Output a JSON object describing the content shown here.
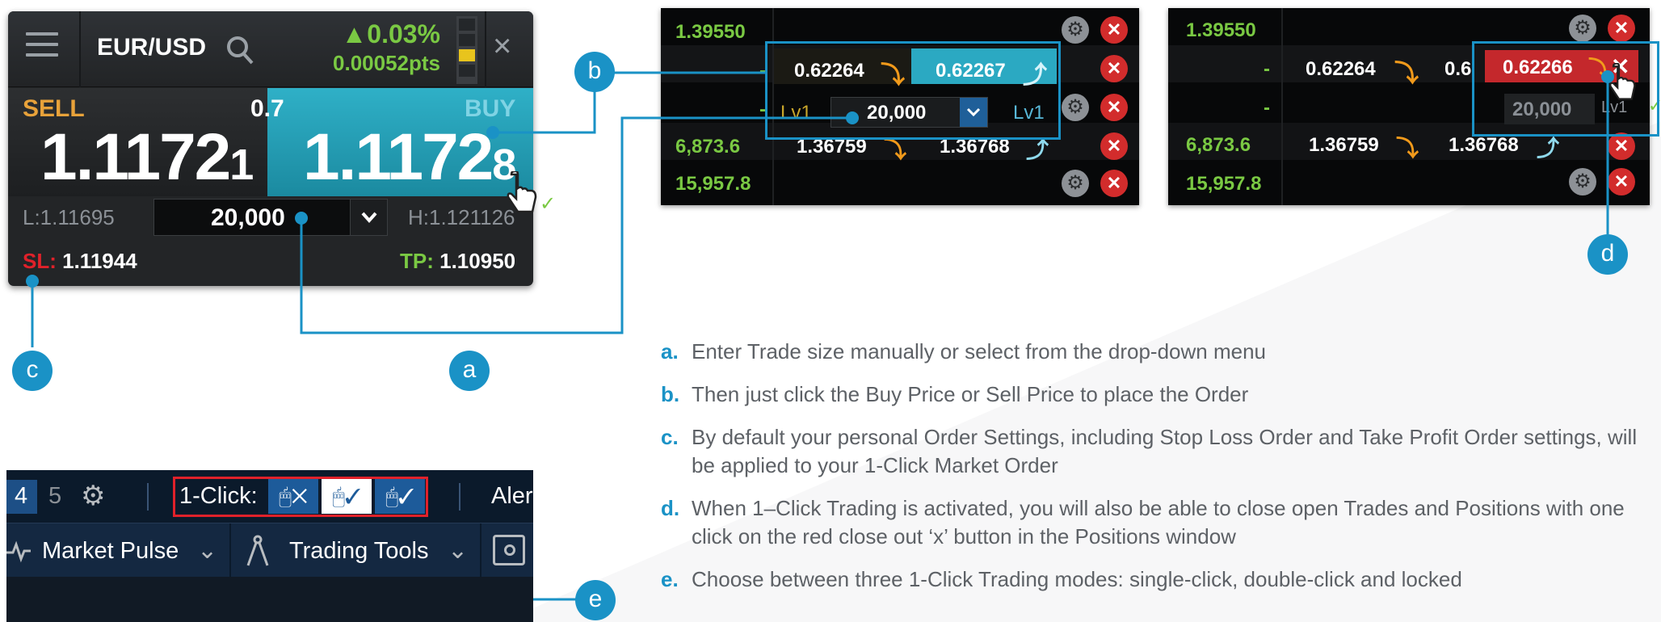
{
  "ticket": {
    "pair": "EUR/USD",
    "change_pct": "▲0.03%",
    "change_pts": "0.00052pts",
    "sell_label": "SELL",
    "buy_label": "BUY",
    "spread": "0.7",
    "sell_big": "1.1172",
    "sell_small": "1",
    "buy_big": "1.1172",
    "buy_small": "8",
    "low": "L:1.11695",
    "high": "H:1.121126",
    "quantity": "20,000",
    "sl_label": "SL:",
    "sl_value": "1.11944",
    "tp_label": "TP:",
    "tp_value": "1.10950"
  },
  "panel_b": {
    "col": [
      "1.39550",
      "-",
      "-",
      "6,873.6",
      "15,957.8"
    ],
    "sell": "0.62264",
    "buy": "0.62267",
    "lv_left": "Lv1",
    "lv_right": "Lv1",
    "qty": "20,000",
    "row4_sell": "1.36759",
    "row4_buy": "1.36768"
  },
  "panel_d": {
    "col": [
      "1.39550",
      "-",
      "-",
      "6,873.6",
      "15,957.8"
    ],
    "sell": "0.62264",
    "buy_partial": "0.6",
    "red_price": "0.62266",
    "qty": "20,000",
    "lv": "Lv1",
    "row4_sell": "1.36759",
    "row4_buy": "1.36768"
  },
  "toolbar": {
    "tab4": "4",
    "tab5": "5",
    "one_click": "1-Click:",
    "alerts": "Aler",
    "market_pulse": "Market Pulse",
    "trading_tools": "Trading Tools"
  },
  "callouts": {
    "a": "a",
    "b": "b",
    "c": "c",
    "d": "d",
    "e": "e"
  },
  "notes": [
    {
      "key": "a.",
      "text": "Enter Trade size manually or select from the drop-down menu"
    },
    {
      "key": "b.",
      "text": "Then just click the Buy Price or Sell Price to place the Order"
    },
    {
      "key": "c.",
      "text": "By default your personal Order Settings, including Stop Loss Order and Take Profit Order settings, will be applied to your 1-Click Market Order"
    },
    {
      "key": "d.",
      "text": "When 1–Click Trading is activated, you will also be able to close open Trades and Positions with one click on the red close out ‘x’ button in the Positions window"
    },
    {
      "key": "e.",
      "text": "Choose between three 1-Click Trading modes: single-click, double-click and locked"
    }
  ],
  "colors": {
    "accent": "#1a92c6",
    "positive": "#7ac943",
    "sell": "#e8a23a",
    "close": "#d22c2c",
    "sl": "#e0212a"
  }
}
